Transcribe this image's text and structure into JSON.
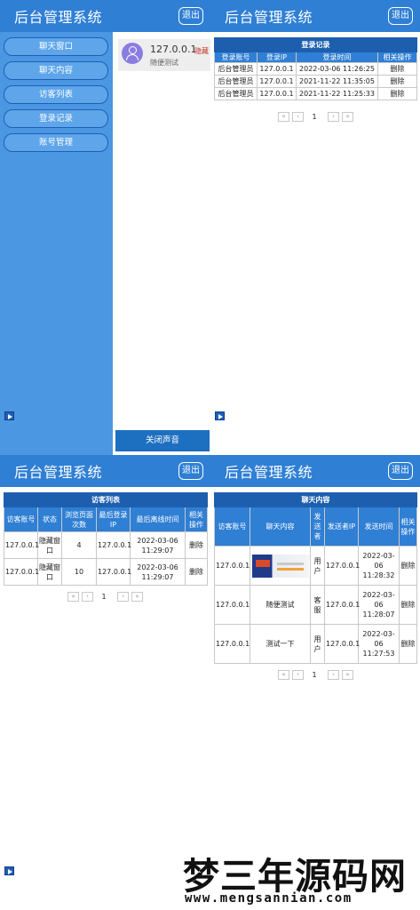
{
  "app": {
    "title": "后台管理系统",
    "logout_label": "退出"
  },
  "sidebar": {
    "items": [
      {
        "label": "聊天窗口"
      },
      {
        "label": "聊天内容"
      },
      {
        "label": "访客列表"
      },
      {
        "label": "登录记录"
      },
      {
        "label": "账号管理"
      }
    ]
  },
  "chat_window": {
    "conversation": {
      "ip": "127.0.0.1",
      "status": "隐藏",
      "preview": "随便测试"
    },
    "mute_button_label": "关闭声音"
  },
  "login_records": {
    "caption": "登录记录",
    "headers": [
      "登录账号",
      "登录IP",
      "登录时间",
      "相关操作"
    ],
    "rows": [
      [
        "后台管理员",
        "127.0.0.1",
        "2022-03-06 11:26:25",
        "删除"
      ],
      [
        "后台管理员",
        "127.0.0.1",
        "2021-11-22 11:35:05",
        "删除"
      ],
      [
        "后台管理员",
        "127.0.0.1",
        "2021-11-22 11:25:33",
        "删除"
      ]
    ]
  },
  "visitor_list": {
    "caption": "访客列表",
    "headers": [
      "访客账号",
      "状态",
      "浏览页面次数",
      "最后登录IP",
      "最后离线时间",
      "相关操作"
    ],
    "rows": [
      [
        "127.0.0.1",
        "隐藏窗口",
        "4",
        "127.0.0.1",
        "2022-03-06 11:29:07",
        "删除"
      ],
      [
        "127.0.0.1",
        "隐藏窗口",
        "10",
        "127.0.0.1",
        "2022-03-06 11:29:07",
        "删除"
      ]
    ]
  },
  "chat_content": {
    "caption": "聊天内容",
    "headers": [
      "访客账号",
      "聊天内容",
      "发送者",
      "发送者IP",
      "发送时间",
      "相关操作"
    ],
    "rows": [
      [
        "127.0.0.1",
        "",
        "用户",
        "127.0.0.1",
        "2022-03-06 11:28:32",
        "删除"
      ],
      [
        "127.0.0.1",
        "随便测试",
        "客服",
        "127.0.0.1",
        "2022-03-06 11:28:07",
        "删除"
      ],
      [
        "127.0.0.1",
        "测试一下",
        "用户",
        "127.0.0.1",
        "2022-03-06 11:27:53",
        "删除"
      ]
    ]
  },
  "pagination": {
    "first": "«",
    "prev": "‹",
    "page": "1",
    "next": "›",
    "last": "»"
  },
  "watermark": {
    "main": "梦三年源码网",
    "sub": "www.mengsannian.com"
  },
  "colors": {
    "header": "#2f7fd4",
    "sidebar": "#4b97e2",
    "table_caption": "#1d5fae"
  }
}
